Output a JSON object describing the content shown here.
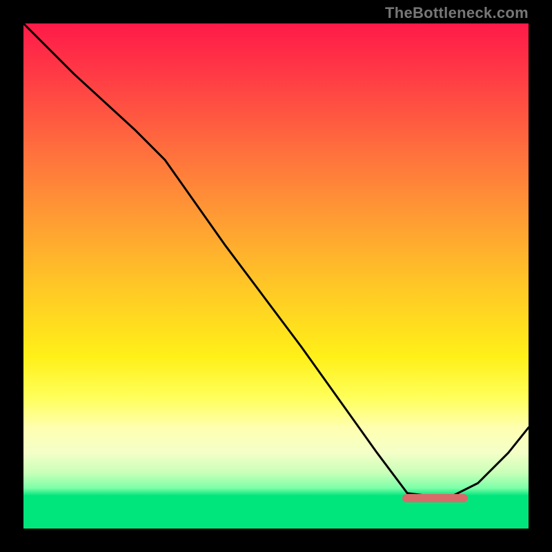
{
  "watermark": "TheBottleneck.com",
  "colors": {
    "frame": "#000000",
    "curve": "#000000",
    "optimum_bar": "#d96a6a",
    "gradient_top": "#ff1a49",
    "gradient_mid": "#fff018",
    "gradient_bottom": "#00e57c"
  },
  "chart_data": {
    "type": "line",
    "title": "",
    "xlabel": "",
    "ylabel": "",
    "xlim": [
      0,
      100
    ],
    "ylim": [
      0,
      100
    ],
    "grid": false,
    "legend": false,
    "annotations": [
      {
        "text": "TheBottleneck.com",
        "position": "top-right"
      }
    ],
    "series": [
      {
        "name": "bottleneck_curve",
        "x": [
          0,
          10,
          22,
          28,
          40,
          55,
          70,
          76,
          84,
          90,
          96,
          100
        ],
        "y": [
          100,
          90,
          79,
          73,
          56,
          36,
          15,
          7,
          6,
          9,
          15,
          20
        ]
      }
    ],
    "optimum_band": {
      "x_start": 75,
      "x_end": 88,
      "y": 6
    }
  }
}
